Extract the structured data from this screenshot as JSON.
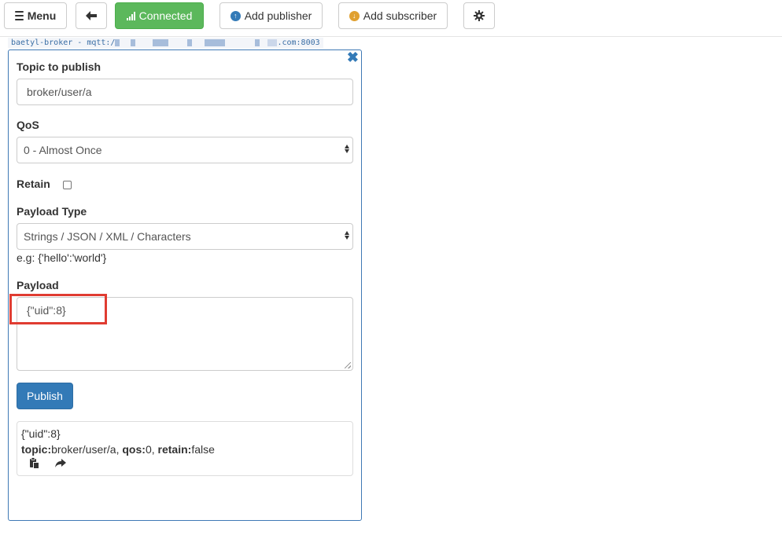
{
  "toolbar": {
    "menu_label": "Menu",
    "connected_label": "Connected",
    "add_publisher_label": "Add publisher",
    "add_subscriber_label": "Add subscriber",
    "connected_color": "#5cb85c"
  },
  "connection": {
    "prefix": "baetyl-broker - mqtt:/",
    "suffix": ".com:8003"
  },
  "publisher": {
    "topic_label": "Topic to publish",
    "topic_value": "broker/user/a",
    "qos_label": "QoS",
    "qos_value": "0 - Almost Once",
    "retain_label": "Retain",
    "payload_type_label": "Payload Type",
    "payload_type_value": "Strings / JSON / XML / Characters",
    "payload_hint": "e.g: {'hello':'world'}",
    "payload_label": "Payload",
    "payload_value": "{\"uid\":8}",
    "publish_label": "Publish",
    "accent_color": "#337ab7",
    "highlight_color": "#e03c31"
  },
  "published_message": {
    "payload": "{\"uid\":8}",
    "topic_key": "topic:",
    "topic_value": "broker/user/a",
    "qos_key": "qos:",
    "qos_value": "0",
    "retain_key": "retain:",
    "retain_value": "false"
  }
}
